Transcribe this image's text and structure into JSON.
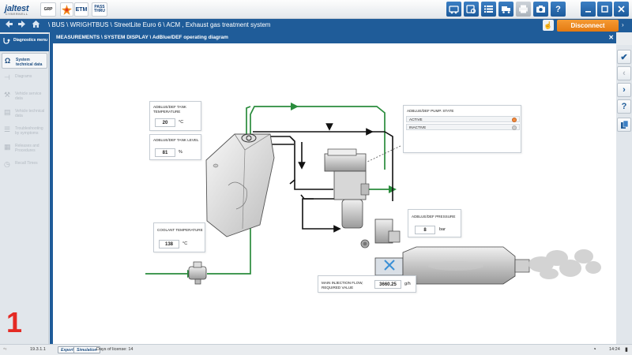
{
  "toolbar": {
    "logo_text": "jaltest",
    "logo_sub": "CYBERNELL",
    "grp_label": "GRP",
    "etm_label": "ETM",
    "pass_label_1": "PASS",
    "pass_label_2": "THRU"
  },
  "nav": {
    "breadcrumb": "\\ BUS \\ WRIGHTBUS \\ StreetLite Euro 6 \\ ACM , Exhaust gas treatment system",
    "disconnect_label": "Disconnect"
  },
  "sidebar": {
    "header": "Diagnostics menu",
    "items": [
      {
        "label": "System technical data"
      },
      {
        "label": "Diagrams"
      },
      {
        "label": "Vehicle service data"
      },
      {
        "label": "Vehicle technical data"
      },
      {
        "label": "Troubleshooting by symptoms"
      },
      {
        "label": "Releases and Procedures"
      },
      {
        "label": "Recall Times"
      }
    ]
  },
  "main": {
    "title": "MEASUREMENTS \\ SYSTEM DISPLAY \\ AdBlue/DEF operating diagram"
  },
  "panels": {
    "tank_temp": {
      "label_1": "ADBLUE/DEF TANK",
      "label_2": "TEMPERATURE",
      "value": "20",
      "unit": "°C"
    },
    "tank_level": {
      "label": "ADBLUE/DEF TANK LEVEL",
      "value": "81",
      "unit": "%"
    },
    "coolant_temp": {
      "label": "COOLANT TEMPERATURE",
      "value": "138",
      "unit": "°C"
    },
    "pump_state": {
      "label": "ADBLUE/DEF PUMP. STATE",
      "active": "ACTIVE",
      "inactive": "INACTIVE"
    },
    "pressure": {
      "label": "ADBLUE/DEF PRESSURE",
      "value": "8",
      "unit": "bar"
    },
    "injection": {
      "label_1": "MAIN INJECTION FLOW,",
      "label_2": "REQUIRED VALUE",
      "value": "3660.25",
      "unit": "g/h"
    }
  },
  "status": {
    "version": "19.3.1.1",
    "export_label": "Export",
    "simulation_label": "Simulation",
    "license": "Days of license: 14",
    "time": "14:24"
  },
  "step_number": "1",
  "colors": {
    "brand_blue": "#1f5c99",
    "disconnect_orange": "#ec8a1f",
    "flow_green": "#2a8c3c",
    "line_black": "#111111",
    "step_red": "#e42a24",
    "active_indicator": "#f08a3e"
  }
}
